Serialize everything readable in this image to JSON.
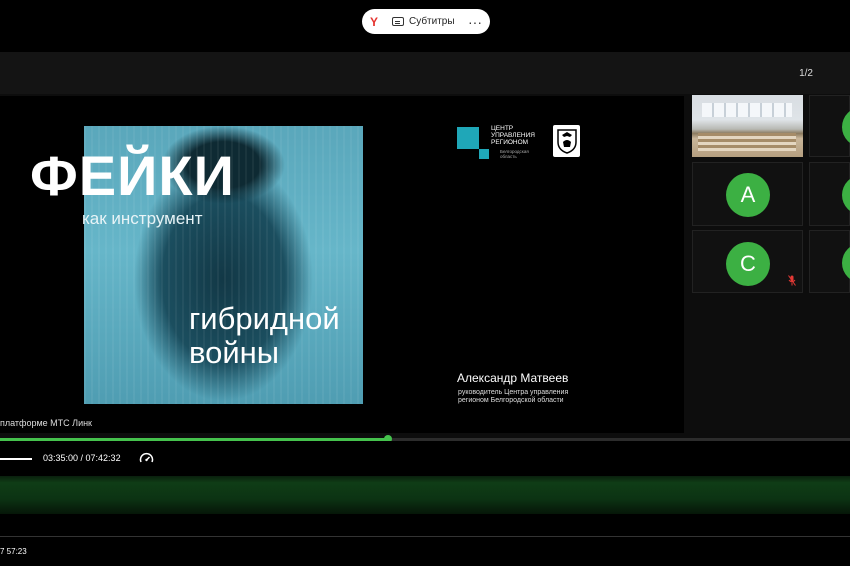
{
  "browser_pill": {
    "brand": "Y",
    "subtitles_label": "Субтитры",
    "more": "···"
  },
  "header": {
    "page_counter": "1/2"
  },
  "slide": {
    "title": "ФЕЙКИ",
    "subtitle1": "как инструмент",
    "subtitle2_line1": "гибридной",
    "subtitle2_line2": "войны",
    "logo_text": "ЦЕНТР УПРАВЛЕНИЯ РЕГИОНОМ",
    "logo_region": "Белгородская область",
    "speaker_name": "Александр Матвеев",
    "speaker_role": "руководитель Центра управления регионом Белгородской области",
    "platform": "платформе МТС Линк",
    "accent_color": "#1fa7b8"
  },
  "participants": [
    {
      "type": "video",
      "name": "room-camera"
    },
    {
      "type": "avatar",
      "initial": "А",
      "color": "#3cb043"
    },
    {
      "type": "avatar",
      "initial": "С",
      "color": "#3cb043",
      "muted": true
    }
  ],
  "player": {
    "time": "03:35:00 / 07:42:32",
    "progress": 0.457,
    "accent_color": "#45c24d",
    "speed_icon": "gauge-icon"
  },
  "taskbar": {
    "clock": "7 57:23"
  }
}
